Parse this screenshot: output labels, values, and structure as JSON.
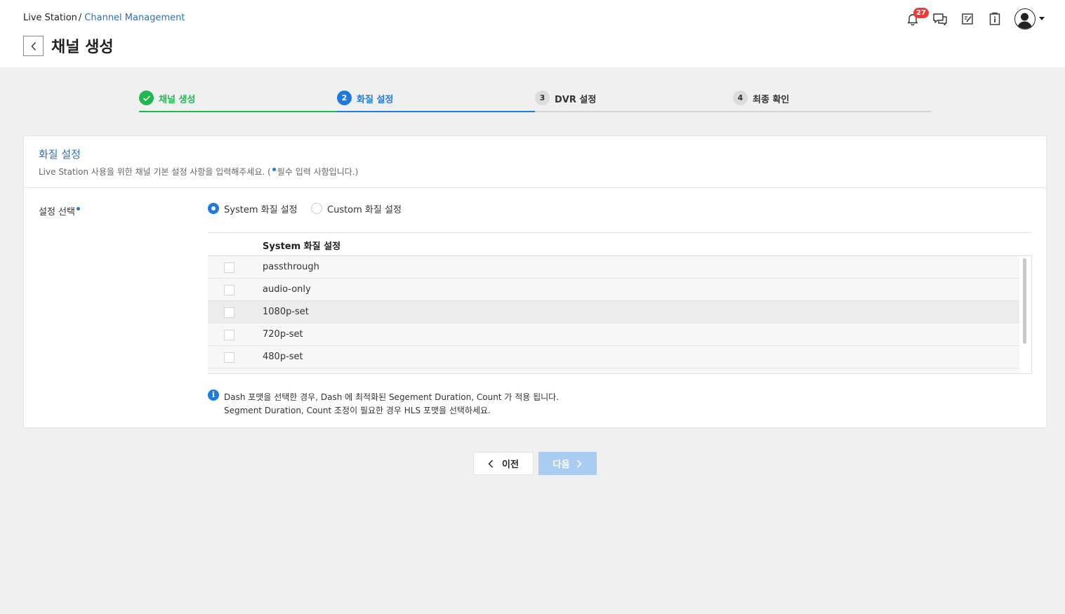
{
  "breadcrumb": {
    "root": "Live Station",
    "separator": "/",
    "current": "Channel Management"
  },
  "page": {
    "title": "채널 생성"
  },
  "header": {
    "notification_count": "27"
  },
  "icons": {
    "back": "chevron-left-icon",
    "notification": "bell-icon",
    "chat": "chat-icon",
    "memo": "note-edit-icon",
    "info": "info-card-icon",
    "user": "user-avatar-icon",
    "dropdown": "caret-down-icon"
  },
  "stepper": {
    "steps": [
      {
        "number": "✓",
        "label": "채널 생성",
        "state": "done"
      },
      {
        "number": "2",
        "label": "화질 설정",
        "state": "active"
      },
      {
        "number": "3",
        "label": "DVR 설정",
        "state": "todo"
      },
      {
        "number": "4",
        "label": "최종 확인",
        "state": "todo"
      }
    ]
  },
  "form": {
    "section_title": "화질 설정",
    "section_subtitle_prefix": "Live Station 사용을 위한 채널 기본 설정 사항을 입력해주세요. (",
    "section_subtitle_suffix": "필수 입력 사항입니다.)",
    "field_label": "설정 선택",
    "radio_options": [
      {
        "label": "System 화질 설정",
        "checked": true
      },
      {
        "label": "Custom 화질 설정",
        "checked": false
      }
    ],
    "table": {
      "header": "System 화질 설정",
      "rows": [
        {
          "name": "passthrough",
          "checked": false
        },
        {
          "name": "audio-only",
          "checked": false
        },
        {
          "name": "1080p-set",
          "checked": false
        },
        {
          "name": "720p-set",
          "checked": false
        },
        {
          "name": "480p-set",
          "checked": false
        }
      ]
    },
    "info_line1": "Dash 포맷을 선택한 경우, Dash 에 최적화된 Segement Duration, Count 가 적용 됩니다.",
    "info_line2": "Segment Duration, Count 조정이 필요한 경우 HLS 포맷을 선택하세요."
  },
  "buttons": {
    "prev": "이전",
    "next": "다음"
  },
  "colors": {
    "primary": "#1f7ae0",
    "success": "#1fb84f",
    "badge": "#ef3b33",
    "link": "#2f6fb8",
    "disabled_button": "#a9cdf0"
  }
}
